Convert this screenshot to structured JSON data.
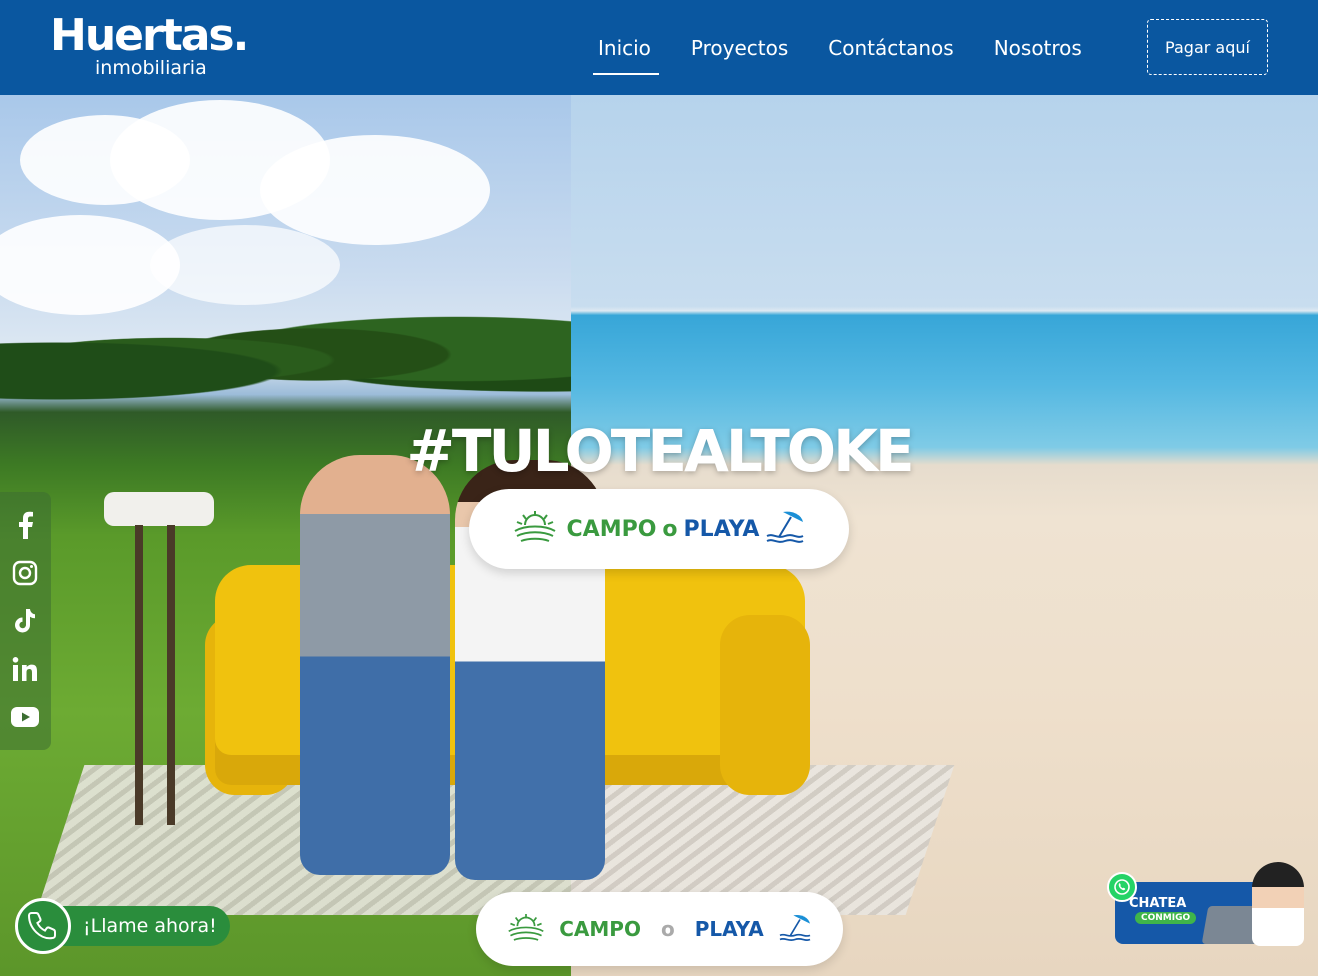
{
  "header": {
    "logo_main": "Huertas.",
    "logo_sub": "inmobiliaria",
    "nav": [
      {
        "label": "Inicio",
        "active": true
      },
      {
        "label": "Proyectos",
        "active": false
      },
      {
        "label": "Contáctanos",
        "active": false
      },
      {
        "label": "Nosotros",
        "active": false
      }
    ],
    "pay_button": "Pagar aquí",
    "color": "#0a57a0"
  },
  "hero": {
    "hashtag": "#TULOTEALTOKE",
    "pill_top": {
      "campo": "CAMPO",
      "o": "o",
      "playa": "PLAYA"
    },
    "pill_bottom": {
      "campo": "CAMPO",
      "o": "o",
      "playa": "PLAYA"
    },
    "campo_color": "#3a9a3f",
    "playa_color": "#1558a8"
  },
  "social": {
    "icons": [
      "facebook-icon",
      "instagram-icon",
      "tiktok-icon",
      "linkedin-icon",
      "youtube-icon"
    ]
  },
  "call": {
    "label": "¡Llame ahora!",
    "icon": "phone-icon"
  },
  "chat": {
    "title": "CHATEA",
    "subtitle": "CONMIGO",
    "icon": "whatsapp-icon"
  }
}
